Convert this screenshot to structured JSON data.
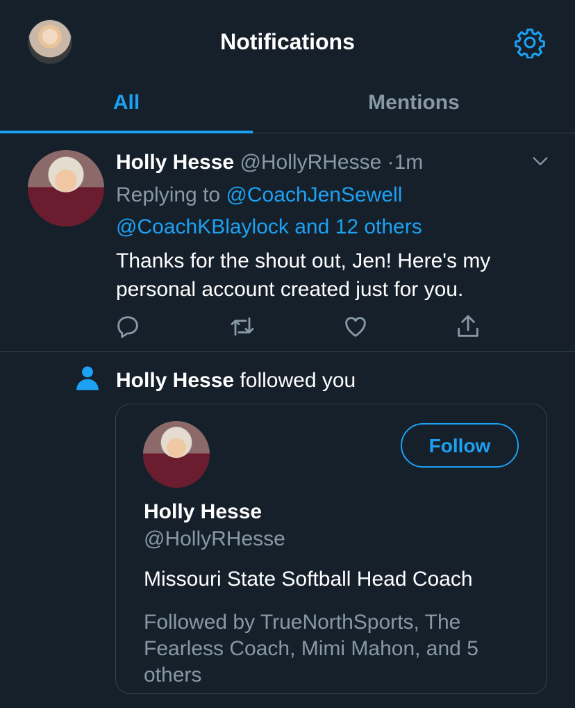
{
  "header": {
    "title": "Notifications",
    "settings_icon": "gear-icon"
  },
  "tabs": [
    {
      "label": "All",
      "active": true
    },
    {
      "label": "Mentions",
      "active": false
    }
  ],
  "tweet": {
    "name": "Holly Hesse",
    "handle": "@HollyRHesse",
    "separator": "·",
    "time": "1m",
    "replying_prefix": "Replying to",
    "reply_to": "@CoachJenSewell",
    "reply_to_2": "@CoachKBlaylock",
    "reply_others": "and 12 others",
    "text": "Thanks for the shout out, Jen! Here's my personal account created just for you.",
    "action_icons": [
      "reply-icon",
      "retweet-icon",
      "like-icon",
      "share-icon"
    ]
  },
  "follow_notification": {
    "name": "Holly Hesse",
    "action_text": " followed you",
    "card": {
      "follow_label": "Follow",
      "name": "Holly Hesse",
      "handle": "@HollyRHesse",
      "bio": "Missouri State Softball Head Coach",
      "followed_by": "Followed by TrueNorthSports, The Fearless Coach, Mimi Mahon, and 5 others"
    }
  },
  "colors": {
    "background": "#15202b",
    "accent": "#1da1f2",
    "secondary_text": "#8899a6",
    "divider": "#38444d"
  }
}
